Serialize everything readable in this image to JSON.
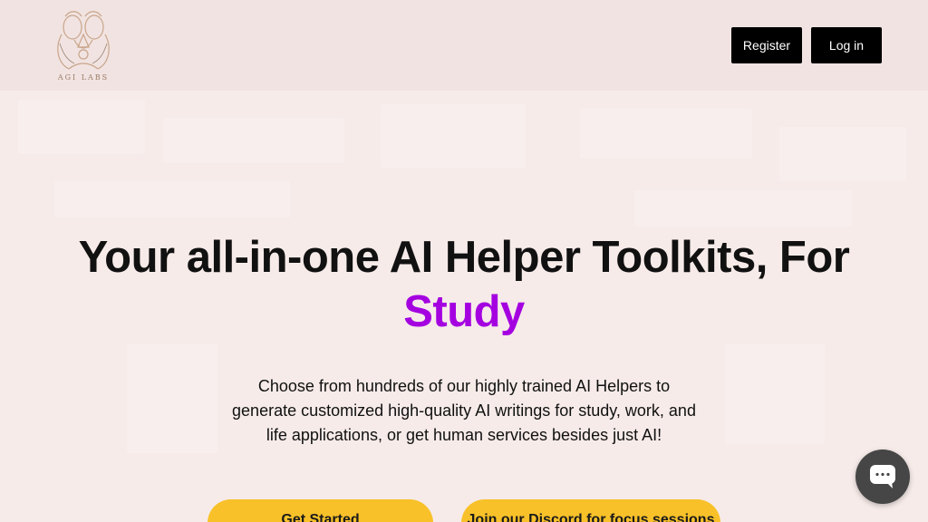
{
  "header": {
    "logo_text": "AGI LABS",
    "register_label": "Register",
    "login_label": "Log in"
  },
  "hero": {
    "title_line1": "Your all-in-one AI Helper Toolkits, For",
    "title_accent": "Study",
    "description": "Choose from hundreds of our highly trained AI Helpers to generate customized high-quality AI writings for study, work, and life applications, or get human services besides just AI!",
    "get_started_label": "Get Started",
    "discord_label": "Join our Discord for focus sessions"
  },
  "chat": {
    "icon": "chat-bubble-icon"
  },
  "colors": {
    "accent": "#a400e0",
    "cta": "#f8c129",
    "header_buttons": "#000000",
    "page_bg": "#f6ebe9"
  }
}
